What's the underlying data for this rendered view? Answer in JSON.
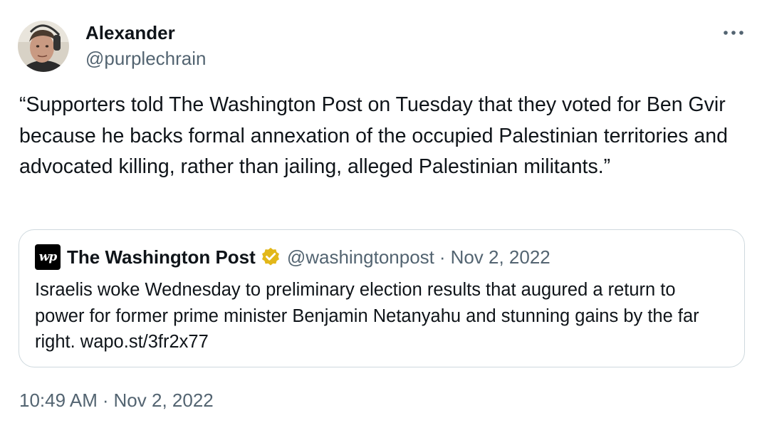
{
  "author": {
    "display_name": "Alexander",
    "handle": "@purplechrain"
  },
  "menu": {
    "icon": "more-horizontal-icon"
  },
  "tweet": {
    "text": "“Supporters told The Washington Post on Tuesday that they voted for Ben Gvir because he backs formal annexation of the occupied Palestinian territories and advocated killing, rather than jailing, alleged Palestinian militants.”"
  },
  "quote": {
    "logo_text": "wp",
    "display_name": "The Washington Post",
    "verified_icon": "verified-badge-icon",
    "verified_color": "#e2b719",
    "handle": "@washingtonpost",
    "separator": "·",
    "date": "Nov 2, 2022",
    "text": "Israelis woke Wednesday to preliminary election results that augured a return to power for former prime minister Benjamin Netanyahu and stunning gains by the far right. wapo.st/3fr2x77"
  },
  "meta": {
    "time": "10:49 AM",
    "separator": "·",
    "date": "Nov 2, 2022"
  },
  "colors": {
    "primary_text": "#0f1419",
    "secondary_text": "#536471",
    "border": "#cfd9de"
  }
}
